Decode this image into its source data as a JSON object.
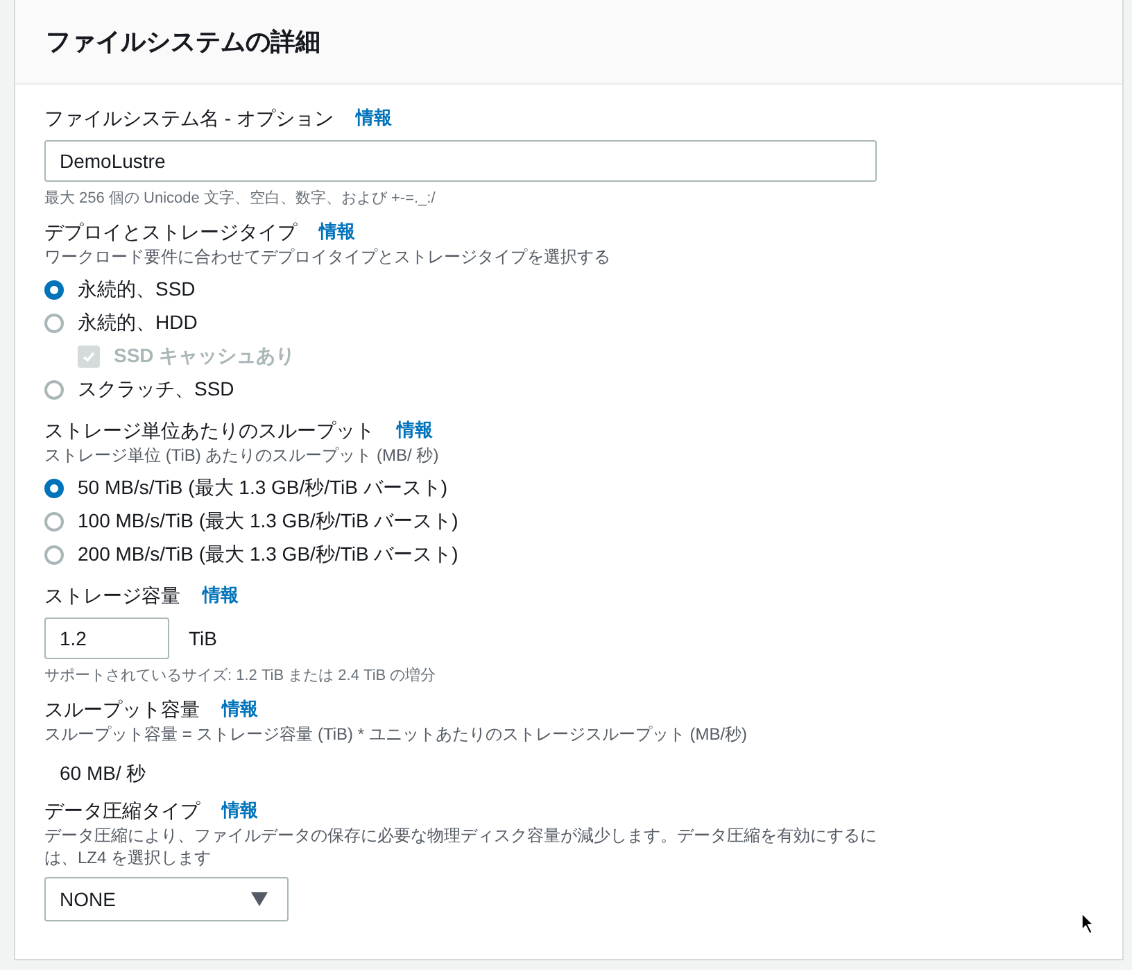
{
  "panel": {
    "title": "ファイルシステムの詳細"
  },
  "fields": [
    {
      "kind": "text",
      "label": "ファイルシステム名 - オプション",
      "info": "情報",
      "value": "DemoLustre",
      "hint": "最大 256 個の Unicode 文字、空白、数字、および +-=._:/"
    },
    {
      "kind": "radios",
      "label": "デプロイとストレージタイプ",
      "info": "情報",
      "description": "ワークロード要件に合わせてデプロイタイプとストレージタイプを選択する",
      "options": [
        {
          "label": "永続的、SSD",
          "selected": true
        },
        {
          "label": "永続的、HDD",
          "selected": false,
          "children": [
            {
              "label": "SSD キャッシュあり",
              "checked": true,
              "disabled": true
            }
          ]
        },
        {
          "label": "スクラッチ、SSD",
          "selected": false
        }
      ]
    },
    {
      "kind": "radios",
      "label": "ストレージ単位あたりのスループット",
      "info": "情報",
      "description": "ストレージ単位 (TiB) あたりのスループット (MB/ 秒)",
      "options": [
        {
          "label": "50 MB/s/TiB (最大 1.3 GB/秒/TiB バースト)",
          "selected": true
        },
        {
          "label": "100 MB/s/TiB (最大 1.3 GB/秒/TiB バースト)",
          "selected": false
        },
        {
          "label": "200 MB/s/TiB (最大 1.3 GB/秒/TiB バースト)",
          "selected": false
        }
      ]
    },
    {
      "kind": "number",
      "label": "ストレージ容量",
      "info": "情報",
      "value": "1.2",
      "unit": "TiB",
      "hint": "サポートされているサイズ: 1.2 TiB または 2.4 TiB の増分"
    },
    {
      "kind": "readout",
      "label": "スループット容量",
      "info": "情報",
      "description": "スループット容量 = ストレージ容量 (TiB) * ユニットあたりのストレージスループット (MB/秒)",
      "value": "60 MB/ 秒"
    },
    {
      "kind": "select",
      "label": "データ圧縮タイプ",
      "info": "情報",
      "description": "データ圧縮により、ファイルデータの保存に必要な物理ディスク容量が減少します。データ圧縮を有効にするには、LZ4 を選択します",
      "value": "NONE"
    }
  ]
}
